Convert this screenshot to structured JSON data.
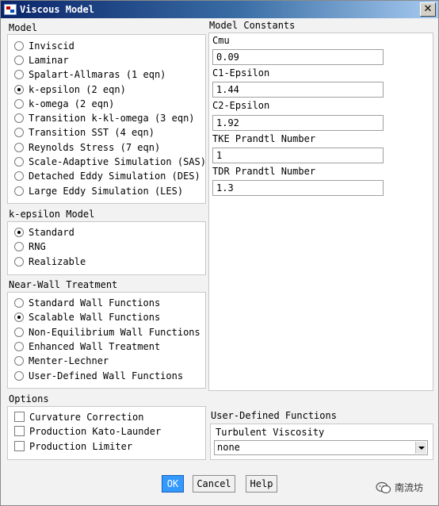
{
  "window": {
    "title": "Viscous Model",
    "close_symbol": "✕"
  },
  "model": {
    "title": "Model",
    "options": [
      {
        "label": "Inviscid",
        "selected": false
      },
      {
        "label": "Laminar",
        "selected": false
      },
      {
        "label": "Spalart-Allmaras (1 eqn)",
        "selected": false
      },
      {
        "label": "k-epsilon (2 eqn)",
        "selected": true
      },
      {
        "label": "k-omega (2 eqn)",
        "selected": false
      },
      {
        "label": "Transition k-kl-omega (3 eqn)",
        "selected": false
      },
      {
        "label": "Transition SST (4 eqn)",
        "selected": false
      },
      {
        "label": "Reynolds Stress (7 eqn)",
        "selected": false
      },
      {
        "label": "Scale-Adaptive Simulation (SAS)",
        "selected": false
      },
      {
        "label": "Detached Eddy Simulation (DES)",
        "selected": false
      },
      {
        "label": "Large Eddy Simulation (LES)",
        "selected": false
      }
    ]
  },
  "k_epsilon_model": {
    "title": "k-epsilon Model",
    "options": [
      {
        "label": "Standard",
        "selected": true
      },
      {
        "label": "RNG",
        "selected": false
      },
      {
        "label": "Realizable",
        "selected": false
      }
    ]
  },
  "near_wall": {
    "title": "Near-Wall Treatment",
    "options": [
      {
        "label": "Standard Wall Functions",
        "selected": false
      },
      {
        "label": "Scalable Wall Functions",
        "selected": true
      },
      {
        "label": "Non-Equilibrium Wall Functions",
        "selected": false
      },
      {
        "label": "Enhanced Wall Treatment",
        "selected": false
      },
      {
        "label": "Menter-Lechner",
        "selected": false
      },
      {
        "label": "User-Defined Wall Functions",
        "selected": false
      }
    ]
  },
  "options": {
    "title": "Options",
    "items": [
      {
        "label": "Curvature Correction",
        "checked": false
      },
      {
        "label": "Production Kato-Launder",
        "checked": false
      },
      {
        "label": "Production Limiter",
        "checked": false
      }
    ]
  },
  "model_constants": {
    "title": "Model Constants",
    "fields": [
      {
        "label": "Cmu",
        "value": "0.09"
      },
      {
        "label": "C1-Epsilon",
        "value": "1.44"
      },
      {
        "label": "C2-Epsilon",
        "value": "1.92"
      },
      {
        "label": "TKE Prandtl Number",
        "value": "1"
      },
      {
        "label": "TDR Prandtl Number",
        "value": "1.3"
      }
    ]
  },
  "user_defined_functions": {
    "title": "User-Defined Functions",
    "turbulent_viscosity_label": "Turbulent Viscosity",
    "turbulent_viscosity_value": "none"
  },
  "buttons": {
    "ok": "OK",
    "cancel": "Cancel",
    "help": "Help"
  },
  "watermark": {
    "text": "南流坊"
  }
}
